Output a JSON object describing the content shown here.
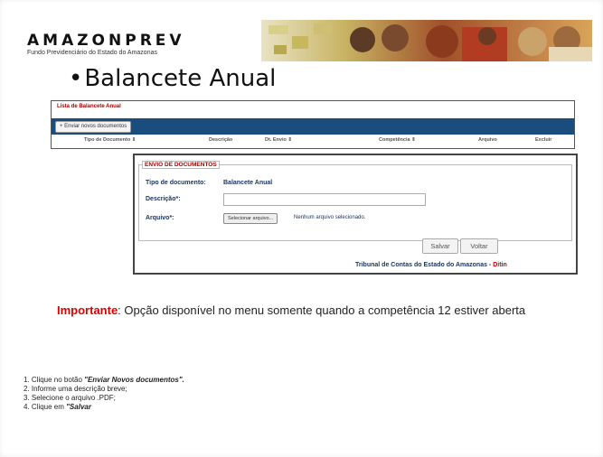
{
  "logo": {
    "word": "AMAZONPREV",
    "sub": "Fundo Previdenciário do Estado do Amazonas"
  },
  "title": "Balancete Anual",
  "list_panel": {
    "title": "Lista de Balancete Anual",
    "send_button": "+ Enviar novos documentos",
    "columns": [
      "Tipo de Documento ⇕",
      "Descrição",
      "Dt. Envio ⇕",
      "Competência ⇕",
      "Arquivo",
      "Excluir"
    ]
  },
  "modal": {
    "legend": "ENVIO DE DOCUMENTOS",
    "tipo_label": "Tipo de documento:",
    "tipo_value": "Balancete Anual",
    "descricao_label": "Descrição*:",
    "descricao_value": "",
    "arquivo_label": "Arquivo*:",
    "file_button": "Selecionar arquivo...",
    "file_status": "Nenhum arquivo selecionado.",
    "save": "Salvar",
    "back": "Voltar",
    "footer": "Tribunal de Contas do Estado do Amazonas -",
    "footer_red": "Ditin"
  },
  "important": {
    "keyword": "Importante",
    "text": ": Opção disponível no menu somente quando a competência 12 estiver aberta"
  },
  "steps": [
    {
      "prefix": "1. Clique no botão ",
      "bold": "\"Enviar Novos documentos\".",
      "suffix": ""
    },
    {
      "prefix": "2. Informe uma descrição breve;",
      "bold": "",
      "suffix": ""
    },
    {
      "prefix": "3. Selecione o arquivo .PDF;",
      "bold": "",
      "suffix": ""
    },
    {
      "prefix": "4. Clique em ",
      "bold": "\"Salvar",
      "suffix": ""
    }
  ],
  "colors": {
    "accent": "#1a4d7e",
    "important": "#d00000",
    "label": "#1c3664"
  }
}
